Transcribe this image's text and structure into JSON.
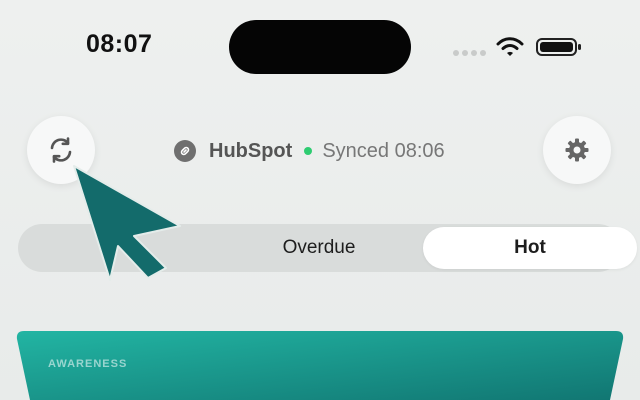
{
  "status_bar": {
    "time": "08:07"
  },
  "header": {
    "source_name": "HubSpot",
    "sync_status": "Synced 08:06"
  },
  "filters": {
    "segments": [
      "",
      "Overdue",
      "Hot"
    ],
    "selected": "Hot"
  },
  "funnel": {
    "stage_label": "AWARENESS"
  },
  "icons": {
    "refresh": "refresh-icon",
    "settings": "gear-icon",
    "link": "link-icon",
    "cursor": "cursor-icon"
  },
  "colors": {
    "sync_dot": "#2ecc71",
    "funnel_start": "#22b5a3",
    "funnel_end": "#117672",
    "cursor": "#136b6b"
  }
}
